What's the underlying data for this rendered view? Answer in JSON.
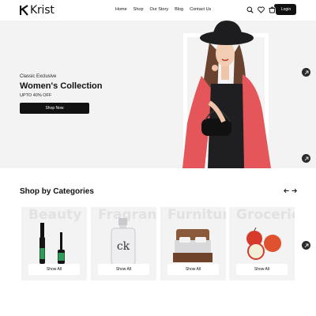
{
  "brand": {
    "name": "Krist"
  },
  "nav": {
    "items": [
      {
        "label": "Home"
      },
      {
        "label": "Shop"
      },
      {
        "label": "Our Story"
      },
      {
        "label": "Blog"
      },
      {
        "label": "Contact Us"
      }
    ]
  },
  "header": {
    "login_label": "Login",
    "icons": [
      "search-icon",
      "heart-icon",
      "cart-icon"
    ],
    "cart_count": ""
  },
  "hero": {
    "subtitle": "Classic Exclusive",
    "title": "Women's Collection",
    "offer": "UPTO 40% OFF",
    "button_label": "Shop Now",
    "model_colors": {
      "coat": "#e4565a",
      "hat": "#1d1d1f"
    }
  },
  "categories": {
    "title": "Shop by Categories",
    "items": [
      {
        "name": "Beauty",
        "button_label": "Show All",
        "icon": "mascara-image"
      },
      {
        "name": "Fragrance",
        "button_label": "Show All",
        "icon": "perfume-image"
      },
      {
        "name": "Furniture",
        "button_label": "Show All",
        "icon": "bed-image"
      },
      {
        "name": "Groceries",
        "button_label": "Show All",
        "icon": "apple-image"
      }
    ]
  }
}
